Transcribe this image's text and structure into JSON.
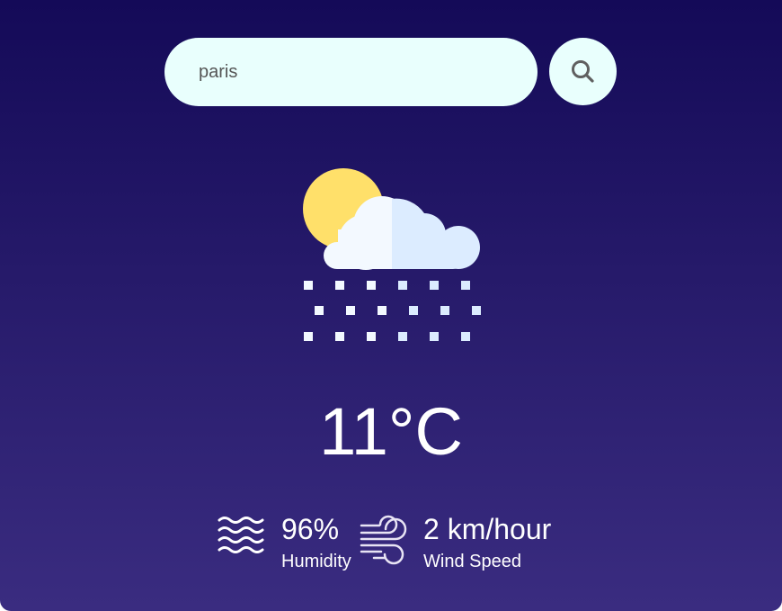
{
  "search": {
    "value": "paris",
    "placeholder": ""
  },
  "weather": {
    "icon": "snow-cloud-sun-icon",
    "temperature": "11°C",
    "humidity": {
      "value": "96%",
      "label": "Humidity",
      "icon": "humidity-waves-icon"
    },
    "wind": {
      "value": "2 km/hour",
      "label": "Wind Speed",
      "icon": "wind-icon"
    }
  },
  "colors": {
    "background_top": "#140a58",
    "background_bottom": "#3a2c80",
    "input_background": "#e9fffd",
    "sun": "#ffe06a",
    "cloud_light": "#f3f9ff",
    "cloud_shade": "#dcecff"
  }
}
